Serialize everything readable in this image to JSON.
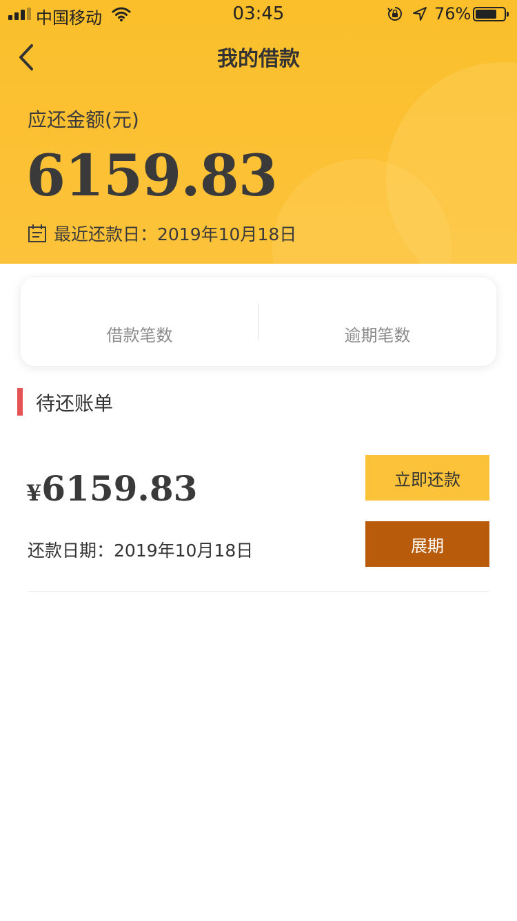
{
  "status_bar": {
    "carrier": "中国移动",
    "time": "03:45",
    "battery_percent": "76%",
    "battery_level": 0.76
  },
  "nav": {
    "title": "我的借款",
    "back_icon": "chevron-left-icon"
  },
  "summary": {
    "due_label": "应还金额(元)",
    "due_amount": "6159.83",
    "due_date_text": "最近还款日：2019年10月18日",
    "calendar_icon": "calendar-icon"
  },
  "stats": {
    "loan_count_label": "借款笔数",
    "overdue_count_label": "逾期笔数"
  },
  "pending": {
    "section_title": "待还账单",
    "bill": {
      "currency": "¥",
      "amount": "6159.83",
      "date_text": "还款日期：2019年10月18日",
      "repay_button": "立即还款",
      "extend_button": "展期"
    }
  },
  "colors": {
    "header_yellow": "#fbbf2b",
    "repay_button": "#fcc23a",
    "extend_button": "#b85b0b",
    "section_accent": "#e55454"
  }
}
